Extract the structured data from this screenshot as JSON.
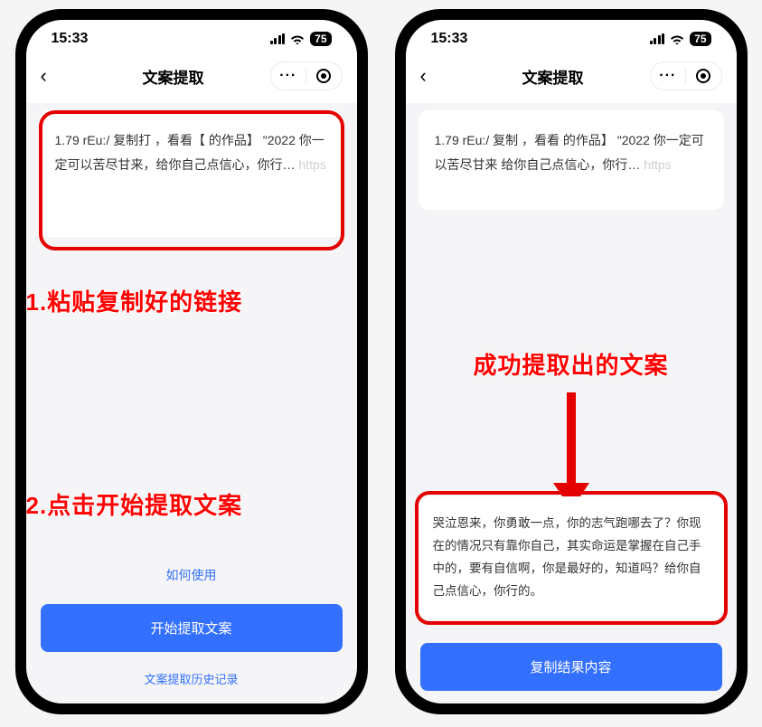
{
  "status": {
    "time": "15:33",
    "battery": "75"
  },
  "left": {
    "nav_title": "文案提取",
    "input_text_1": "1.79 rEu:/ 复制打",
    "input_text_2": "，看看【",
    "input_text_3": "的作品】 \"2022 你一定可以苦尽甘来，给你自己点信心，你行…",
    "input_url": "https",
    "how_to_use": "如何使用",
    "primary_btn": "开始提取文案",
    "history_link": "文案提取历史记录",
    "annotation_1": "1.粘贴复制好的链接",
    "annotation_2": "2.点击开始提取文案"
  },
  "right": {
    "nav_title": "文案提取",
    "input_text_1": "1.79 rEu:/ 复制",
    "input_text_2": "，看看",
    "input_text_3": "的作品】 \"2022 你一定可以苦尽甘来   给你自己点信心，你行…",
    "input_url": "https",
    "annotation_3": "成功提取出的文案",
    "result_text": "哭泣恩来，你勇敢一点，你的志气跑哪去了？你现在的情况只有靠你自己，其实命运是掌握在自己手中的，要有自信啊，你是最好的，知道吗？给你自己点信心，你行的。",
    "primary_btn": "复制结果内容"
  }
}
